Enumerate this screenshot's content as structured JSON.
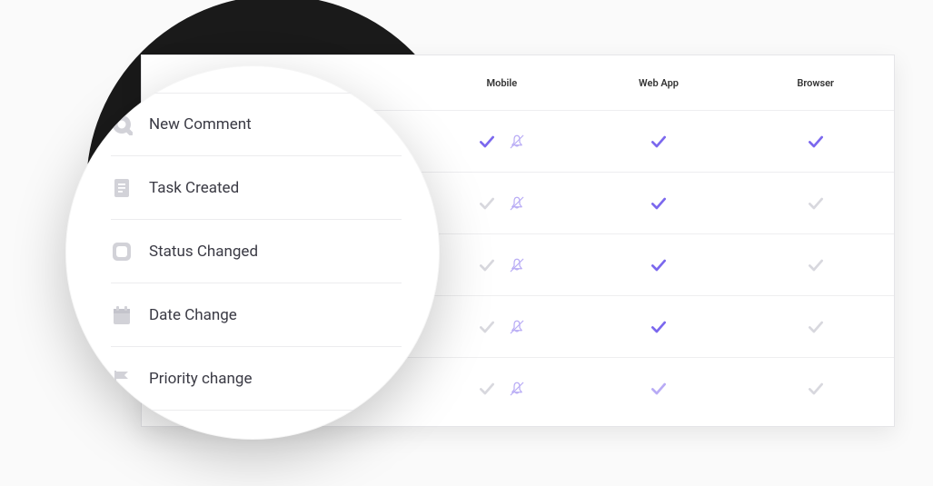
{
  "columns": [
    "Mobile",
    "Web App",
    "Browser"
  ],
  "rows": [
    {
      "icon": "comment",
      "label": "New Comment",
      "mobile_check": "purple",
      "mobile_mute": "lpurp",
      "web": "purple",
      "browser": "purple"
    },
    {
      "icon": "doc",
      "label": "Task Created",
      "mobile_check": "grey",
      "mobile_mute": "lpurp",
      "web": "purple",
      "browser": "grey"
    },
    {
      "icon": "status",
      "label": "Status Changed",
      "mobile_check": "grey",
      "mobile_mute": "lpurp",
      "web": "purple",
      "browser": "grey"
    },
    {
      "icon": "calendar",
      "label": "Date Change",
      "mobile_check": "grey",
      "mobile_mute": "lpurp",
      "web": "purple",
      "browser": "grey"
    },
    {
      "icon": "flag",
      "label": "Priority change",
      "mobile_check": "grey",
      "mobile_mute": "lpurp",
      "web": "lpurp",
      "browser": "grey"
    }
  ]
}
